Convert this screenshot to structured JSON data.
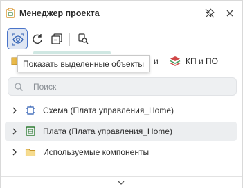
{
  "window": {
    "title": "Менеджер проекта",
    "icons": {
      "title": "project-manager-icon",
      "pin": "pin-icon",
      "close": "close-icon"
    }
  },
  "toolbar": {
    "buttons": [
      {
        "name": "show-selected",
        "icon": "eye-select-icon",
        "active": true
      },
      {
        "name": "refresh",
        "icon": "refresh-icon",
        "active": false
      },
      {
        "name": "collapse-all",
        "icon": "collapse-icon",
        "active": false
      },
      {
        "name": "find",
        "icon": "find-icon",
        "active": false
      }
    ]
  },
  "tooltip": {
    "text": "Показать выделенные объекты"
  },
  "tabs": {
    "partial_text": "и",
    "kp_label": "КП и ПО",
    "kp_icon": "layers-icon"
  },
  "search": {
    "placeholder": "Поиск",
    "value": ""
  },
  "tree": {
    "items": [
      {
        "label": "Схема (Плата управления_Home)",
        "icon": "schematic-icon"
      },
      {
        "label": "Плата (Плата управления_Home)",
        "icon": "pcb-icon"
      },
      {
        "label": "Используемые компоненты",
        "icon": "folder-icon"
      }
    ]
  },
  "colors": {
    "accent": "#4a74c9",
    "active_bg": "#dfe6f3",
    "tab_active": "#cfe7e2",
    "icon_blue": "#2f5fb3",
    "kp_red": "#d04848",
    "kp_green": "#3f9a5a",
    "folder_yellow": "#e9b949",
    "pcb_green": "#2e7d32"
  }
}
